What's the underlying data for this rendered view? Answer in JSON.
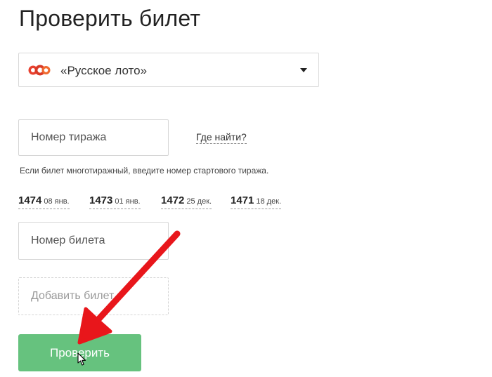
{
  "page": {
    "title": "Проверить билет"
  },
  "game_select": {
    "value": "«Русское лото»",
    "icon": "russian-loto-balls-icon"
  },
  "draw_field": {
    "placeholder": "Номер тиража"
  },
  "where_link": {
    "label": "Где найти?"
  },
  "hint": {
    "text": "Если билет многотиражный, введите номер стартового тиража."
  },
  "recent_draws": [
    {
      "number": "1474",
      "date": "08 янв."
    },
    {
      "number": "1473",
      "date": "01 янв."
    },
    {
      "number": "1472",
      "date": "25 дек."
    },
    {
      "number": "1471",
      "date": "18 дек."
    }
  ],
  "ticket_field": {
    "placeholder": "Номер билета"
  },
  "add_ticket": {
    "placeholder": "Добавить билет"
  },
  "submit": {
    "label": "Проверить"
  },
  "colors": {
    "button": "#66c27e",
    "arrow": "#e8161b"
  }
}
